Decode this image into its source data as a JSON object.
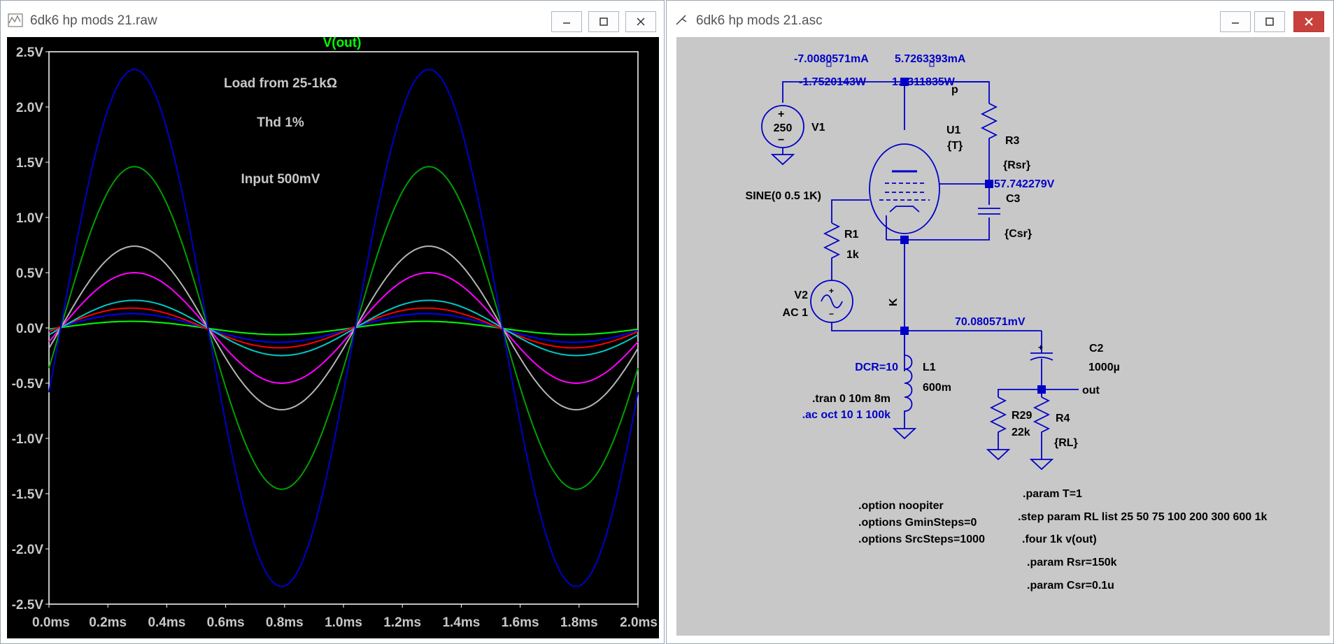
{
  "plot_window": {
    "title": "6dk6 hp mods 21.raw",
    "trace_label": "V(out)",
    "annotations": [
      "Load from 25-1kΩ",
      "Thd 1%",
      "Input 500mV"
    ]
  },
  "schematic_window": {
    "title": "6dk6 hp mods 21.asc",
    "labels": {
      "i1": "-7.0080571mA",
      "i2": "5.7263393mA",
      "p1": "-1.7520143W",
      "p2": "1.4311835W",
      "node_p": "p",
      "v1_value": "250",
      "v1_name": "V1",
      "u1_name": "U1",
      "u1_value": "{T}",
      "r3_name": "R3",
      "r3_value": "{Rsr}",
      "screen_v": "57.742279V",
      "c3_name": "C3",
      "c3_value": "{Csr}",
      "sine": "SINE(0 0.5 1K)",
      "r1_name": "R1",
      "r1_value": "1k",
      "v2_name": "V2",
      "v2_value": "AC 1",
      "node_k": "K",
      "k_v": "70.080571mV",
      "c2_name": "C2",
      "c2_value": "1000µ",
      "dcr": "DCR=10",
      "l1_name": "L1",
      "l1_value": "600m",
      "tran": ".tran 0 10m 8m",
      "ac": ".ac oct 10 1 100k",
      "r29_name": "R29",
      "r29_value": "22k",
      "r4_name": "R4",
      "r4_value": "{RL}",
      "node_out": "out"
    },
    "directives_left": [
      ".option noopiter",
      ".options GminSteps=0",
      ".options SrcSteps=1000"
    ],
    "directives_right": [
      ".param T=1",
      ".step param RL list 25 50 75 100 200 300 600 1k",
      ".four 1k v(out)",
      ".param Rsr=150k",
      ".param Csr=0.1u"
    ]
  },
  "chart_data": {
    "type": "line",
    "title": "V(out)",
    "xlabel": "",
    "ylabel": "",
    "x_ticks": [
      "0.0ms",
      "0.2ms",
      "0.4ms",
      "0.6ms",
      "0.8ms",
      "1.0ms",
      "1.2ms",
      "1.4ms",
      "1.6ms",
      "1.8ms",
      "2.0ms"
    ],
    "y_ticks": [
      "2.5V",
      "2.0V",
      "1.5V",
      "1.0V",
      "0.5V",
      "0.0V",
      "-0.5V",
      "-1.0V",
      "-1.5V",
      "-2.0V",
      "-2.5V"
    ],
    "xlim": [
      0,
      2.0
    ],
    "ylim": [
      -2.5,
      2.5
    ],
    "waveform": "sine, 1 kHz, phase offsets per curve",
    "series": [
      {
        "color": "#00ff00",
        "amplitude": 0.06,
        "phase_shift_ms": 0.03
      },
      {
        "color": "#0000ff",
        "amplitude": 0.13,
        "phase_shift_ms": 0.03
      },
      {
        "color": "#ff0000",
        "amplitude": 0.18,
        "phase_shift_ms": 0.03
      },
      {
        "color": "#00c8c8",
        "amplitude": 0.25,
        "phase_shift_ms": 0.04
      },
      {
        "color": "#ff00ff",
        "amplitude": 0.5,
        "phase_shift_ms": 0.04
      },
      {
        "color": "#b4b4b4",
        "amplitude": 0.74,
        "phase_shift_ms": 0.04
      },
      {
        "color": "#00a000",
        "amplitude": 1.46,
        "phase_shift_ms": 0.04
      },
      {
        "color": "#0000c8",
        "amplitude": 2.34,
        "phase_shift_ms": 0.04
      }
    ]
  }
}
